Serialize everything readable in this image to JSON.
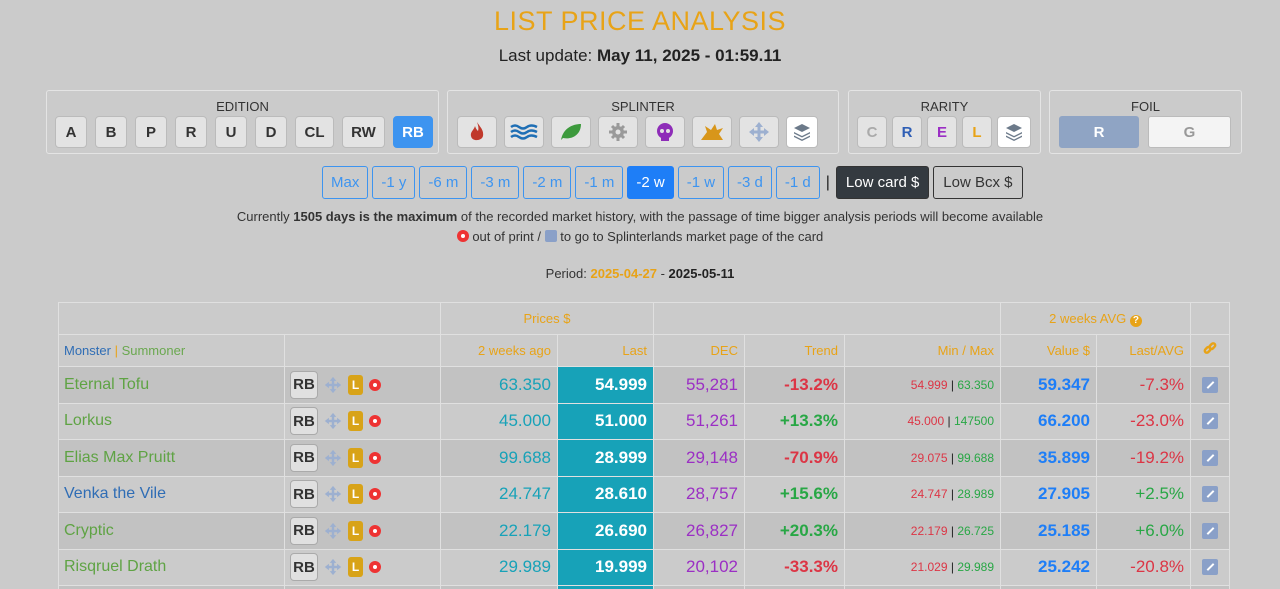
{
  "header": {
    "title": "LIST PRICE ANALYSIS",
    "update_label": "Last update:",
    "update_value": "May 11, 2025 - 01:59.11"
  },
  "filters": {
    "edition": {
      "title": "EDITION",
      "items": [
        "A",
        "B",
        "P",
        "R",
        "U",
        "D",
        "CL",
        "RW",
        "RB"
      ],
      "active": "RB"
    },
    "splinter": {
      "title": "SPLINTER",
      "items": [
        "fire-icon",
        "water-icon",
        "earth-icon",
        "neutral-icon",
        "death-icon",
        "dragon-icon",
        "life-icon",
        "all-layers-icon"
      ]
    },
    "rarity": {
      "title": "RARITY",
      "items": [
        "C",
        "R",
        "E",
        "L"
      ]
    },
    "foil": {
      "title": "FOIL",
      "items": [
        "R",
        "G"
      ],
      "active": "R"
    }
  },
  "periods": [
    "Max",
    "-1 y",
    "-6 m",
    "-3 m",
    "-2 m",
    "-1 m",
    "-2 w",
    "-1 w",
    "-3 d",
    "-1 d"
  ],
  "active_period": "-2 w",
  "separator": "|",
  "currency_buttons": {
    "low_card": "Low card $",
    "low_bcx": "Low Bcx $"
  },
  "info": {
    "line1_pre": "Currently ",
    "line1_bold": "1505 days is the maximum",
    "line1_post": " of the recorded market history, with the passage of time bigger analysis periods will become available",
    "line2_a": " out of print / ",
    "line2_b": " to go to Splinterlands market page of the card"
  },
  "period": {
    "label": "Period:",
    "start": "2025-04-27",
    "dash": " - ",
    "end": "2025-05-11"
  },
  "table": {
    "group_prices": "Prices $",
    "group_avg": "2 weeks AVG",
    "col_monster": "Monster",
    "col_sep": " | ",
    "col_summoner": "Summoner",
    "col_2w": "2 weeks ago",
    "col_last": "Last",
    "col_dec": "DEC",
    "col_trend": "Trend",
    "col_minmax": "Min / Max",
    "col_value": "Value $",
    "col_lastavg": "Last/AVG",
    "rows": [
      {
        "name": "Eternal Tofu",
        "edition": "RB",
        "rarity": "L",
        "w2": "63.350",
        "last": "54.999",
        "dec": "55,281",
        "trend": "-13.2%",
        "min": "54.999",
        "max": "63.350",
        "value": "59.347",
        "lastavg": "-7.3%"
      },
      {
        "name": "Lorkus",
        "edition": "RB",
        "rarity": "L",
        "w2": "45.000",
        "last": "51.000",
        "dec": "51,261",
        "trend": "+13.3%",
        "min": "45.000",
        "max": "147500",
        "value": "66.200",
        "lastavg": "-23.0%"
      },
      {
        "name": "Elias Max Pruitt",
        "edition": "RB",
        "rarity": "L",
        "w2": "99.688",
        "last": "28.999",
        "dec": "29,148",
        "trend": "-70.9%",
        "min": "29.075",
        "max": "99.688",
        "value": "35.899",
        "lastavg": "-19.2%"
      },
      {
        "name": "Venka the Vile",
        "edition": "RB",
        "rarity": "L",
        "w2": "24.747",
        "last": "28.610",
        "dec": "28,757",
        "trend": "+15.6%",
        "min": "24.747",
        "max": "28.989",
        "value": "27.905",
        "lastavg": "+2.5%"
      },
      {
        "name": "Cryptic",
        "edition": "RB",
        "rarity": "L",
        "w2": "22.179",
        "last": "26.690",
        "dec": "26,827",
        "trend": "+20.3%",
        "min": "22.179",
        "max": "26.725",
        "value": "25.185",
        "lastavg": "+6.0%"
      },
      {
        "name": "Risqruel Drath",
        "edition": "RB",
        "rarity": "L",
        "w2": "29.989",
        "last": "19.999",
        "dec": "20,102",
        "trend": "-33.3%",
        "min": "21.029",
        "max": "29.989",
        "value": "25.242",
        "lastavg": "-20.8%"
      }
    ]
  },
  "colors": {
    "accent": "#e8a317",
    "primary": "#1e7ef7",
    "teal": "#17a2b8",
    "dec": "#9b2fc4",
    "positive": "#28a745",
    "negative": "#dc3545"
  }
}
